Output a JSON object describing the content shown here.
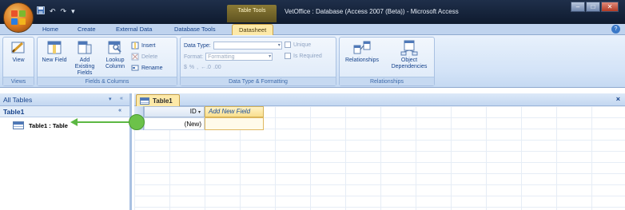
{
  "title_bar": {
    "context_tools_label": "Table Tools",
    "app_title": "VetOffice : Database (Access 2007 (Beta)) - Microsoft Access",
    "qat_undo": "↶",
    "qat_redo": "↷",
    "qat_dropdown": "▾",
    "window_minimize": "–",
    "window_maximize": "□",
    "window_close": "✕"
  },
  "office_logo_colors": [
    "#e8522b",
    "#7cb82f",
    "#2a7de1",
    "#f2b51c"
  ],
  "tabs": [
    "Home",
    "Create",
    "External Data",
    "Database Tools",
    "Datasheet"
  ],
  "active_tab": "Datasheet",
  "help_label": "?",
  "ribbon": {
    "views": {
      "view_label": "View",
      "group_label": "Views"
    },
    "fields_columns": {
      "new_field_label": "New Field",
      "add_existing_fields_label": "Add Existing Fields",
      "lookup_column_label": "Lookup Column",
      "insert_label": "Insert",
      "delete_label": "Delete",
      "rename_label": "Rename",
      "group_label": "Fields & Columns"
    },
    "data_type": {
      "data_type_label": "Data Type:",
      "data_type_value": "",
      "format_label": "Format:",
      "format_value": "Formatting",
      "currency_symbol": "$",
      "percent_symbol": "%",
      "comma_symbol": ",",
      "dec_increase": "←.0",
      "dec_decrease": ".00",
      "unique_label": "Unique",
      "is_required_label": "Is Required",
      "group_label": "Data Type & Formatting"
    },
    "relationships": {
      "relationships_label": "Relationships",
      "object_dependencies_label": "Object Dependencies",
      "group_label": "Relationships"
    }
  },
  "nav_pane": {
    "header": "All Tables",
    "header_dropdown": "▾",
    "header_collapse": "«",
    "group_name": "Table1",
    "group_toggle": "«",
    "item_label": "Table1 : Table"
  },
  "document": {
    "tab_label": "Table1",
    "close_label": "×",
    "columns": [
      "ID",
      "Add New Field"
    ],
    "id_sort_indicator": "▾",
    "new_row_id": "(New)",
    "new_row_field": ""
  },
  "accent_colors": {
    "pointer": "#5cb843",
    "active_tab": "#fde9a8",
    "ribbon_bg": "#d3e3f7"
  }
}
